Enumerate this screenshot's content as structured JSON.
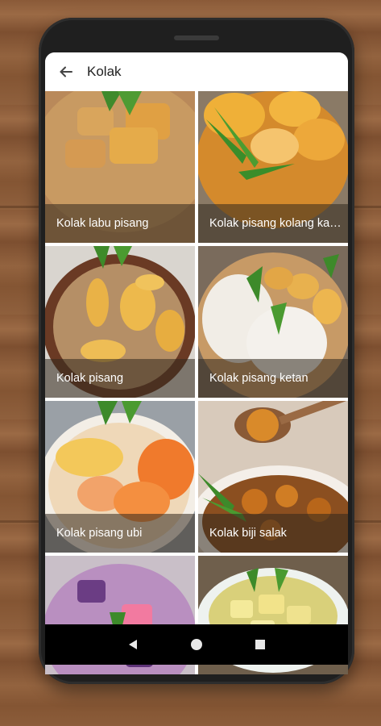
{
  "app": {
    "title": "Kolak"
  },
  "recipes": [
    {
      "label": "Kolak labu pisang"
    },
    {
      "label": "Kolak pisang kolang kaling"
    },
    {
      "label": "Kolak pisang"
    },
    {
      "label": "Kolak pisang ketan"
    },
    {
      "label": "Kolak pisang ubi"
    },
    {
      "label": "Kolak biji salak"
    },
    {
      "label": ""
    },
    {
      "label": ""
    }
  ],
  "icons": {
    "back": "arrow-left-icon",
    "nav_back": "triangle-back-icon",
    "nav_home": "circle-home-icon",
    "nav_recents": "square-recents-icon"
  },
  "colors": {
    "caption_overlay": "#32281e",
    "phone_body": "#1f1f1f",
    "navbar": "#000000"
  }
}
